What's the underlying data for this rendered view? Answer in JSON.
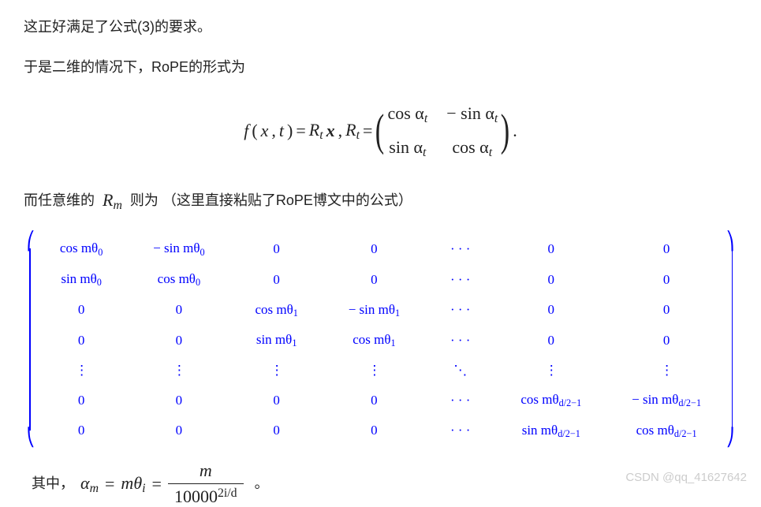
{
  "paragraphs": {
    "p1": "这正好满足了公式(3)的要求。",
    "p2": "于是二维的情况下，RoPE的形式为",
    "p3_pre": "而任意维的",
    "p3_mid": "R",
    "p3_midsub": "m",
    "p3_post": "则为 （这里直接粘贴了RoPE博文中的公式）",
    "p4_pre": "其中，"
  },
  "formula_main": {
    "f": "f",
    "lparen": "(",
    "x": "x",
    "comma": ", ",
    "t": "t",
    "rparen": ")",
    "eq": " = ",
    "R": "R",
    "tsub": "t",
    "xbold": "x",
    "R2": "R",
    "tsub2": "t",
    "eq2": " = ",
    "m00": "cos α",
    "m01": "− sin α",
    "m10": "sin α",
    "m11": "cos α",
    "alpha_sub": "t",
    "dot": "."
  },
  "big_matrix_rows": [
    [
      "cos mθ",
      "− sin mθ",
      "0",
      "0",
      "· · ·",
      "0",
      "0"
    ],
    [
      "sin mθ",
      "cos mθ",
      "0",
      "0",
      "· · ·",
      "0",
      "0"
    ],
    [
      "0",
      "0",
      "cos mθ",
      "− sin mθ",
      "· · ·",
      "0",
      "0"
    ],
    [
      "0",
      "0",
      "sin mθ",
      "cos mθ",
      "· · ·",
      "0",
      "0"
    ],
    [
      "⋮",
      "⋮",
      "⋮",
      "⋮",
      "⋱",
      "⋮",
      "⋮"
    ],
    [
      "0",
      "0",
      "0",
      "0",
      "· · ·",
      "cos mθ",
      "− sin mθ"
    ],
    [
      "0",
      "0",
      "0",
      "0",
      "· · ·",
      "sin mθ",
      "cos mθ"
    ]
  ],
  "big_matrix_subs": {
    "r0": "0",
    "r1": "0",
    "r2": "1",
    "r3": "1",
    "r5": "d/2−1",
    "r6": "d/2−1"
  },
  "final": {
    "alpha": "α",
    "m_sub": "m",
    "eq1": " = ",
    "m": "m",
    "theta": "θ",
    "i_sub": "i",
    "eq2": " = ",
    "num": "m",
    "den_base": "10000",
    "den_exp": "2i/d",
    "end": "。"
  },
  "watermark": "CSDN @qq_41627642"
}
